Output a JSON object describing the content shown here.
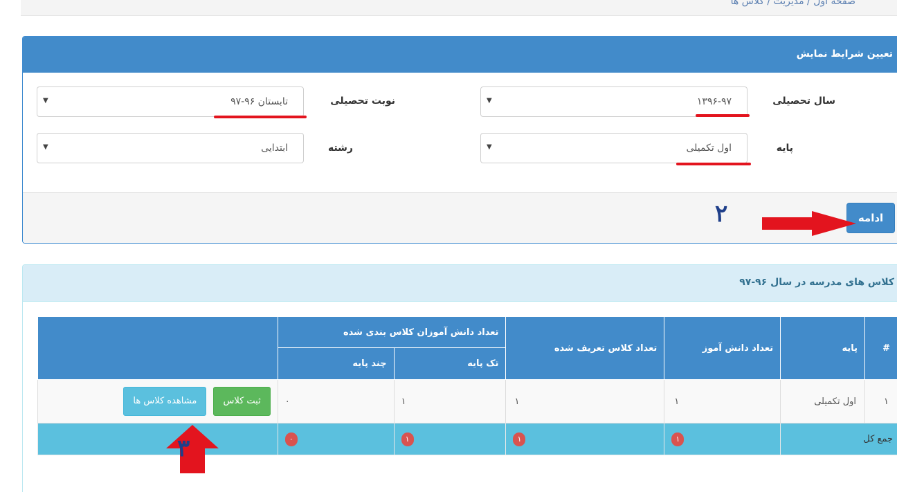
{
  "breadcrumb": {
    "text": "صفحه اول / مدیریت / کلاس ها"
  },
  "filter_panel": {
    "title": "تعیین شرایط نمایش",
    "year_label": "سال تحصیلی",
    "year_value": "۱۳۹۶-۹۷",
    "term_label": "نوبت تحصیلی",
    "term_value": "تابستان ۹۶-۹۷",
    "grade_label": "پایه",
    "grade_value": "اول تکمیلی",
    "field_label": "رشته",
    "field_value": "ابتدایی",
    "caret": "▼",
    "continue_label": "ادامه",
    "step_marker": "۲"
  },
  "classes_panel": {
    "title": "کلاس های مدرسه در سال ۹۶-۹۷",
    "columns": {
      "index": "#",
      "grade": "پایه",
      "students": "تعداد دانش آموز",
      "defined_classes": "تعداد کلاس تعریف شده",
      "assigned_students": "تعداد دانش آموزان کلاس بندی شده",
      "single_grade": "تک پایه",
      "multi_grade": "چند پایه"
    },
    "rows": [
      {
        "index": "۱",
        "grade": "اول تکمیلی",
        "students": "۱",
        "defined_classes": "۱",
        "single_grade": "۱",
        "multi_grade": "۰",
        "register_button": "ثبت کلاس",
        "view_button": "مشاهده کلاس ها"
      }
    ],
    "total": {
      "label": "جمع کل",
      "students": "۱",
      "defined_classes": "۱",
      "single_grade": "۱",
      "multi_grade": "۰"
    },
    "step_marker": "۳"
  },
  "colors": {
    "primary": "#428bca",
    "info": "#5bc0de",
    "success": "#5cb85c",
    "danger": "#d9534f",
    "annotation_red": "#e3141e",
    "annotation_blue": "#1f3f8a"
  },
  "icons": {
    "dropdown": "caret-down-icon",
    "annotation_right": "red-arrow-right-icon",
    "annotation_up": "red-arrow-up-icon"
  }
}
